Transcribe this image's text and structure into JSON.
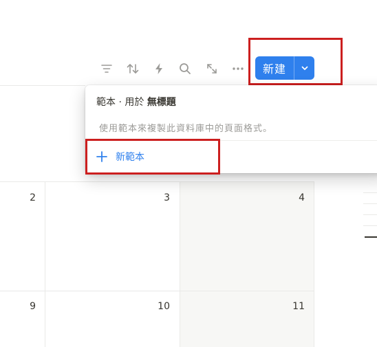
{
  "toolbar": {
    "icons": [
      "filter-icon",
      "sort-icon",
      "lightning-icon",
      "search-icon",
      "expand-icon",
      "more-icon"
    ],
    "new_label": "新建",
    "accent": "#2f80ed"
  },
  "template_menu": {
    "title_prefix": "範本 · 用於",
    "title_db": "無標題",
    "description": "使用範本來複製此資料庫中的頁面格式。",
    "new_template_label": "新範本"
  },
  "calendar": {
    "row1": [
      "2",
      "3",
      "4"
    ],
    "row2": [
      "9",
      "10",
      "11"
    ]
  },
  "colors": {
    "highlight_red": "#cc1f1f",
    "weekend_bg": "#f7f7f5"
  }
}
